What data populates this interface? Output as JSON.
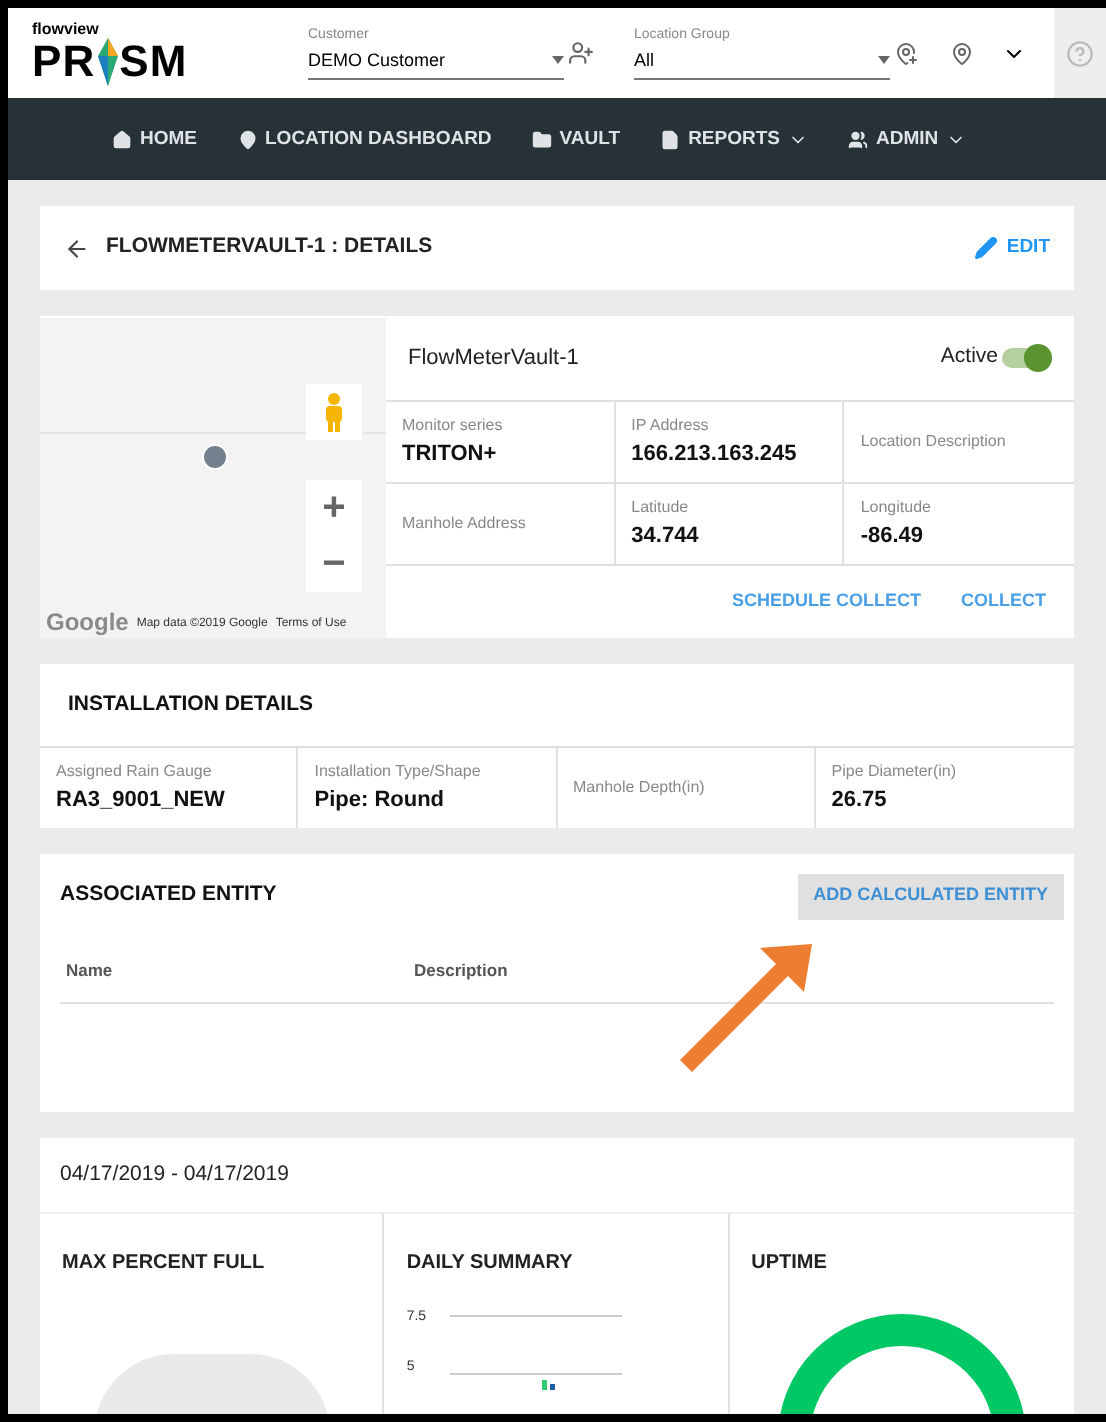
{
  "header": {
    "logo_small": "flowview",
    "logo_big_left": "PR",
    "logo_big_right": "SM",
    "customer": {
      "label": "Customer",
      "value": "DEMO Customer"
    },
    "location_group": {
      "label": "Location Group",
      "value": "All"
    }
  },
  "nav": [
    {
      "label": "HOME",
      "kind": "home",
      "caret": false
    },
    {
      "label": "LOCATION DASHBOARD",
      "kind": "pin",
      "caret": false
    },
    {
      "label": "VAULT",
      "kind": "folder",
      "caret": false
    },
    {
      "label": "REPORTS",
      "kind": "file",
      "caret": true
    },
    {
      "label": "ADMIN",
      "kind": "people",
      "caret": true
    }
  ],
  "title_bar": {
    "title": "FLOWMETERVAULT-1 : DETAILS",
    "edit": "EDIT"
  },
  "map": {
    "attribution": "Map data ©2019 Google",
    "terms": "Terms of Use",
    "logo": "Google",
    "zoom_in": "+",
    "zoom_out": "−"
  },
  "location": {
    "name": "FlowMeterVault-1",
    "active_label": "Active",
    "active": true,
    "fields": [
      {
        "label": "Monitor series",
        "value": "TRITON+"
      },
      {
        "label": "IP Address",
        "value": "166.213.163.245"
      },
      {
        "label": "Location Description"
      },
      {
        "label": "Manhole Address"
      },
      {
        "label": "Latitude",
        "value": "34.744"
      },
      {
        "label": "Longitude",
        "value": "-86.49"
      }
    ],
    "actions": [
      "SCHEDULE COLLECT",
      "COLLECT"
    ]
  },
  "installation": {
    "title": "INSTALLATION DETAILS",
    "fields": [
      {
        "label": "Assigned Rain Gauge",
        "value": "RA3_9001_NEW"
      },
      {
        "label": "Installation Type/Shape",
        "value": "Pipe: Round"
      },
      {
        "label": "Manhole Depth(in)"
      },
      {
        "label": "Pipe Diameter(in)",
        "value": "26.75"
      }
    ]
  },
  "associated_entity": {
    "title": "ASSOCIATED ENTITY",
    "button": "ADD CALCULATED ENTITY",
    "columns": [
      "Name",
      "Description"
    ]
  },
  "summary": {
    "date_range": "04/17/2019 - 04/17/2019",
    "panels": [
      {
        "kind": "gauge",
        "title": "MAX PERCENT FULL"
      },
      {
        "kind": "bars",
        "title": "DAILY SUMMARY",
        "axis_labels": [
          "7.5",
          "5"
        ]
      },
      {
        "kind": "donut",
        "title": "UPTIME"
      }
    ]
  }
}
